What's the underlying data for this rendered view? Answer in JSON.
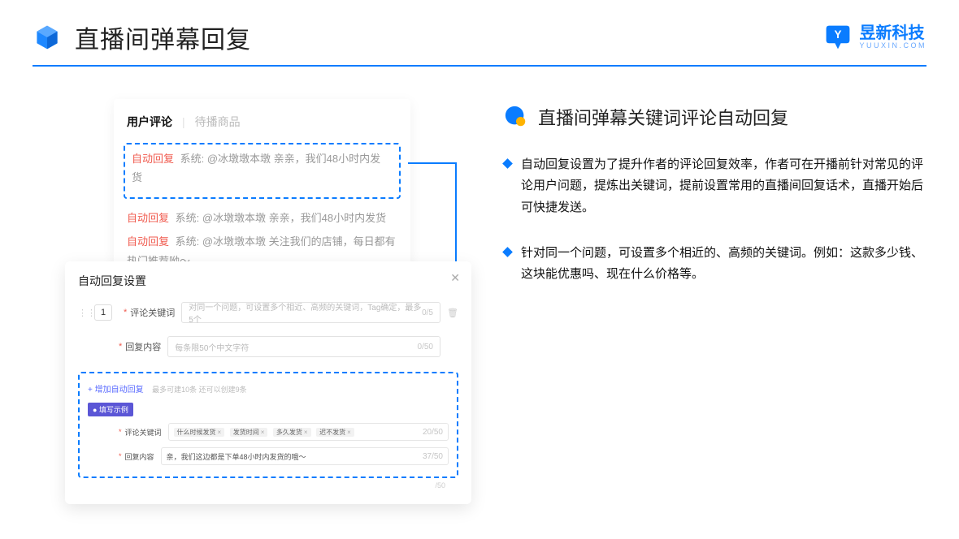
{
  "header": {
    "title": "直播间弹幕回复"
  },
  "brand": {
    "name": "昱新科技",
    "sub": "YUUXIN.COM"
  },
  "commentsCard": {
    "tab_active": "用户评论",
    "tab_other": "待播商品",
    "highlighted_comment": "系统: @冰墩墩本墩 亲亲，我们48小时内发货",
    "comment2": "系统: @冰墩墩本墩 亲亲，我们48小时内发货",
    "comment3": "系统: @冰墩墩本墩 关注我们的店铺，每日都有热门推荐呦～",
    "auto_label": "自动回复"
  },
  "settingsModal": {
    "title": "自动回复设置",
    "idx": "1",
    "keyword_label": "评论关键词",
    "keyword_placeholder": "对同一个问题，可设置多个相近、高频的关键词，Tag确定，最多5个",
    "keyword_count": "0/5",
    "content_label": "回复内容",
    "content_placeholder": "每条限50个中文字符",
    "content_count": "0/50",
    "add_link": "+ 增加自动回复",
    "add_note": "最多可建10条 还可以创建9条",
    "example_badge": "● 填写示例",
    "example_keyword_label": "评论关键词",
    "example_tags": [
      "什么时候发货",
      "发货时间",
      "多久发货",
      "迟不发货"
    ],
    "example_keyword_count": "20/50",
    "example_content_label": "回复内容",
    "example_content_value": "亲，我们这边都是下单48小时内发货的哦～",
    "example_content_count": "37/50",
    "outside_count": "/50"
  },
  "rightPane": {
    "section_title": "直播间弹幕关键词评论自动回复",
    "bullet1": "自动回复设置为了提升作者的评论回复效率，作者可在开播前针对常见的评论用户问题，提炼出关键词，提前设置常用的直播间回复话术，直播开始后可快捷发送。",
    "bullet2": "针对同一个问题，可设置多个相近的、高频的关键词。例如：这款多少钱、这块能优惠吗、现在什么价格等。"
  }
}
